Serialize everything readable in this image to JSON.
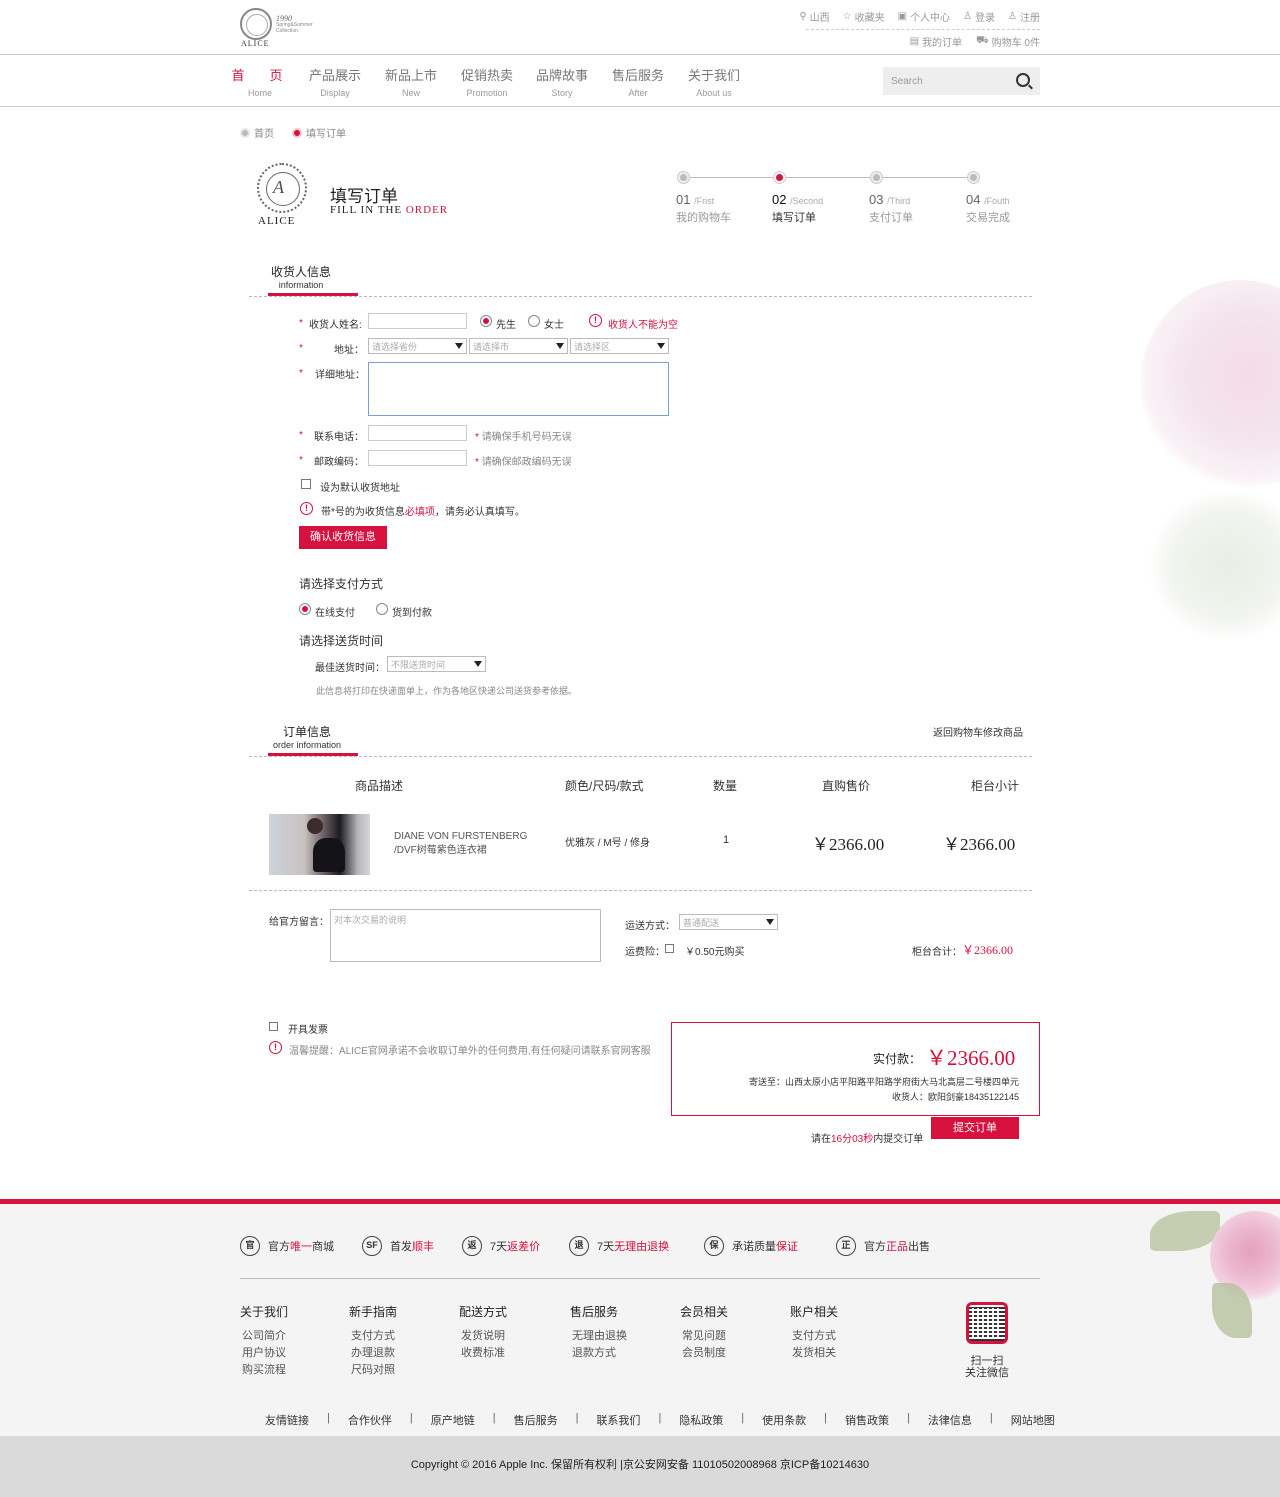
{
  "brand": {
    "wordmark": "ALICE",
    "year": "1990",
    "tagline": "Spring&Summer Collection"
  },
  "top_links": {
    "location": "山西",
    "favorites": "收藏夹",
    "account": "个人中心",
    "login": "登录",
    "register": "注册",
    "my_orders": "我的订单",
    "cart": "购物车 0件"
  },
  "nav": [
    {
      "cn": "首　页",
      "en": "Home"
    },
    {
      "cn": "产品展示",
      "en": "Display"
    },
    {
      "cn": "新品上市",
      "en": "New"
    },
    {
      "cn": "促销热卖",
      "en": "Promotion"
    },
    {
      "cn": "品牌故事",
      "en": "Story"
    },
    {
      "cn": "售后服务",
      "en": "After"
    },
    {
      "cn": "关于我们",
      "en": "About us"
    }
  ],
  "search": {
    "placeholder": "Search"
  },
  "breadcrumb": [
    "首页",
    "填写订单"
  ],
  "page_header": {
    "logo_word": "ALICE",
    "title_cn": "填写订单",
    "title_en_a": "FILL IN THE ",
    "title_en_b": "ORDER"
  },
  "steps": [
    {
      "num": "01",
      "en": "/Frist",
      "label": "我的购物车"
    },
    {
      "num": "02",
      "en": "/Second",
      "label": "填写订单"
    },
    {
      "num": "03",
      "en": "/Third",
      "label": "支付订单"
    },
    {
      "num": "04",
      "en": "/Fouth",
      "label": "交易完成"
    }
  ],
  "consignee": {
    "section_cn": "收货人信息",
    "section_en": "information",
    "required_mark": "*",
    "name_label": "收货人姓名:",
    "name_value": "",
    "salutation_mr": "先生",
    "salutation_ms": "女士",
    "name_error": "收货人不能为空",
    "address_label": "地址：",
    "province_placeholder": "请选择省份",
    "city_placeholder": "请选择市",
    "district_placeholder": "请选择区",
    "detail_label": "详细地址：",
    "phone_label": "联系电话：",
    "phone_hint": "请确保手机号码无误",
    "zip_label": "邮政编码：",
    "zip_hint": "请确保邮政编码无误",
    "default_addr": "设为默认收货地址",
    "note_a": "带*号的为收货信息",
    "note_b": "必填项",
    "note_c": "，请务必认真填写。",
    "confirm_button": "确认收货信息"
  },
  "payment": {
    "title": "请选择支付方式",
    "online": "在线支付",
    "cod": "货到付款"
  },
  "delivery": {
    "title": "请选择送货时间",
    "best_time_label": "最佳送货时间：",
    "best_time_value": "不限送货时间",
    "note": "此信息将打印在快递面单上，作为各地区快递公司送货参考依据。"
  },
  "order": {
    "section_cn": "订单信息",
    "section_en": "order information",
    "back_link": "返回购物车修改商品",
    "headers": [
      "商品描述",
      "颜色/尺码/款式",
      "数量",
      "直购售价",
      "柜台小计"
    ],
    "item": {
      "name_line1": "DIANE VON FURSTENBERG",
      "name_line2": "/DVF树莓紫色连衣裙",
      "spec": "优雅灰 / M号 / 修身",
      "qty": "1",
      "price": "￥2366.00",
      "subtotal": "￥2366.00"
    },
    "remark_label": "给官方留言：",
    "remark_placeholder": "对本次交易的说明",
    "shipping_label": "运送方式：",
    "shipping_value": "普通配送",
    "insurance_label": "运费险：",
    "insurance_value": "￥0.50元购买",
    "counter_total_label": "柜台合计：",
    "counter_total_value": "￥2366.00"
  },
  "invoice": {
    "label": "开具发票",
    "warning": "温馨提醒：ALICE官网承诺不会收取订单外的任何费用,有任何疑问请联系官网客服"
  },
  "summary": {
    "pay_label": "实付款：",
    "pay_amount": "￥2366.00",
    "ship_to": "寄送至：山西太原小店平阳路平阳路学府街大马北高层二号楼四单元",
    "receiver": "收货人：欧阳剑豪18435122145",
    "countdown_a": "请在",
    "countdown_b": "16分03秒",
    "countdown_c": "内提交订单",
    "submit_button": "提交订单"
  },
  "guarantees": [
    {
      "icon": "官",
      "text_a": "官方",
      "text_b": "唯一",
      "text_c": "商城"
    },
    {
      "icon": "SF",
      "text_a": "首发",
      "text_b": "顺丰",
      "text_c": ""
    },
    {
      "icon": "返",
      "text_a": "7天",
      "text_b": "返差价",
      "text_c": ""
    },
    {
      "icon": "退",
      "text_a": "7天",
      "text_b": "无理由退换",
      "text_c": ""
    },
    {
      "icon": "保",
      "text_a": "承诺质量",
      "text_b": "保证",
      "text_c": ""
    },
    {
      "icon": "正",
      "text_a": "官方",
      "text_b": "正品",
      "text_c": "出售"
    }
  ],
  "footer_cols": [
    {
      "title": "关于我们",
      "links": [
        "公司简介",
        "用户协议",
        "购买流程"
      ]
    },
    {
      "title": "新手指南",
      "links": [
        "支付方式",
        "办理退款",
        "尺码对照"
      ]
    },
    {
      "title": "配送方式",
      "links": [
        "发货说明",
        "收费标准"
      ]
    },
    {
      "title": "售后服务",
      "links": [
        "无理由退换",
        "退款方式"
      ]
    },
    {
      "title": "会员相关",
      "links": [
        "常见问题",
        "会员制度"
      ]
    },
    {
      "title": "账户相关",
      "links": [
        "支付方式",
        "发货相关"
      ]
    }
  ],
  "qr": {
    "line1": "扫一扫",
    "line2": "关注微信"
  },
  "footer_links": [
    "友情链接",
    "合作伙伴",
    "原产地链",
    "售后服务",
    "联系我们",
    "隐私政策",
    "使用条款",
    "销售政策",
    "法律信息",
    "网站地图"
  ],
  "copyright": "Copyright © 2016 Apple Inc. 保留所有权利  |京公安网安备 11010502008968 京ICP备10214630",
  "colors": {
    "accent": "#d6113e",
    "footer_bg": "#f4f4f4",
    "copyright_bg": "#dadada"
  }
}
